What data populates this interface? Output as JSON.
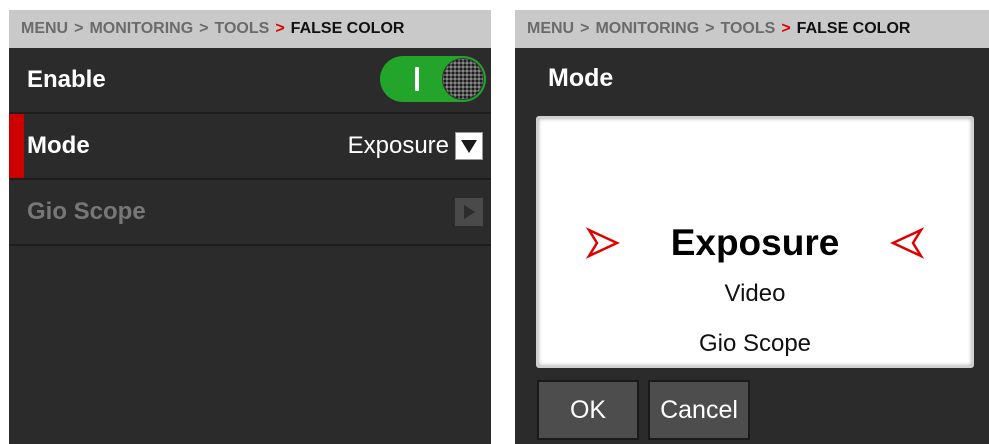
{
  "left": {
    "breadcrumb": {
      "menu": "MENU",
      "monitoring": "MONITORING",
      "tools": "TOOLS",
      "current": "FALSE COLOR",
      "sep": ">"
    },
    "rows": {
      "enable": {
        "label": "Enable",
        "toggle_on": true
      },
      "mode": {
        "label": "Mode",
        "value": "Exposure"
      },
      "gio": {
        "label": "Gio Scope"
      }
    }
  },
  "right": {
    "breadcrumb": {
      "menu": "MENU",
      "monitoring": "MONITORING",
      "tools": "TOOLS",
      "current": "FALSE COLOR",
      "sep": ">"
    },
    "title": "Mode",
    "picker": {
      "selected": "Exposure",
      "options": [
        "Video",
        "Gio Scope"
      ]
    },
    "buttons": {
      "ok": "OK",
      "cancel": "Cancel"
    }
  },
  "colors": {
    "accent_red": "#e00000",
    "toggle_green": "#22a52a",
    "panel_bg": "#2b2b2b",
    "breadcrumb_bg": "#c9c9c9"
  },
  "icons": {
    "dropdown": "chevron-down-icon",
    "submenu": "chevron-right-icon",
    "picker_markers": "picker-arrow-icon"
  }
}
